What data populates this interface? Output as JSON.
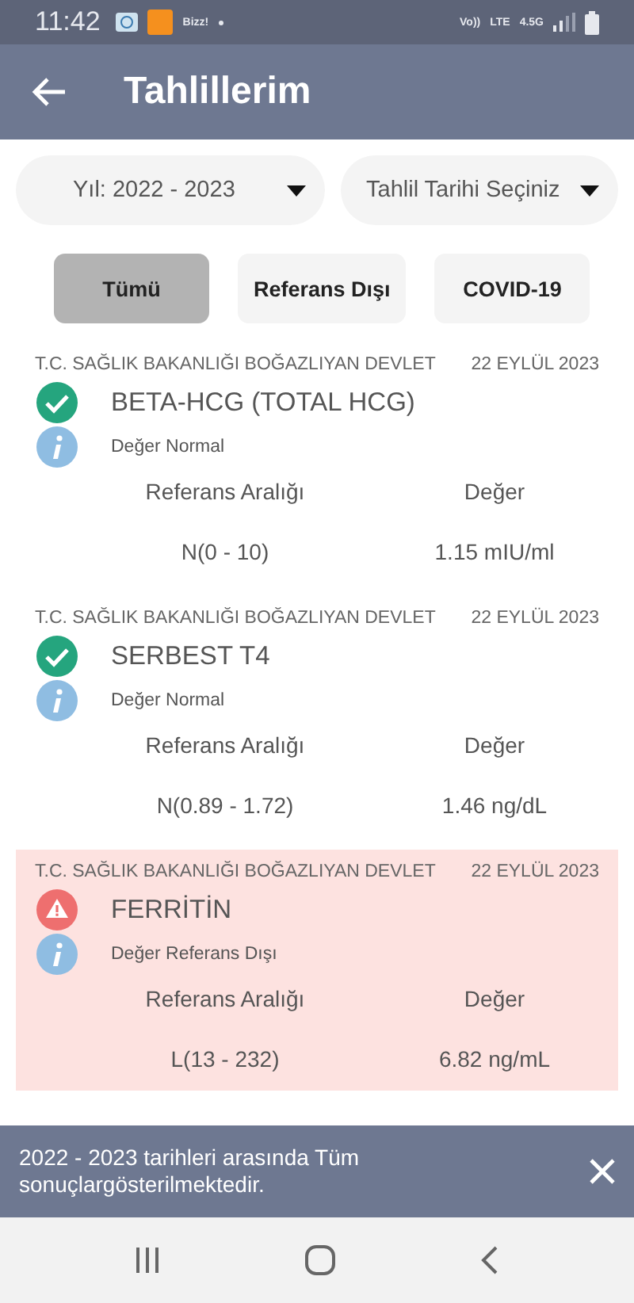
{
  "status_bar": {
    "time": "11:42",
    "notification_label": "Bizz!",
    "network_texts": [
      "Vo))",
      "LTE",
      "4.5G"
    ]
  },
  "app_bar": {
    "title": "Tahlillerim"
  },
  "filters": [
    {
      "label": "Yıl: 2022 - 2023"
    },
    {
      "label": "Tahlil Tarihi Seçiniz"
    }
  ],
  "tabs": [
    {
      "label": "Tümü",
      "selected": true
    },
    {
      "label": "Referans Dışı",
      "selected": false
    },
    {
      "label": "COVID-19",
      "selected": false
    }
  ],
  "results": [
    {
      "institution": "T.C. SAĞLIK BAKANLIĞI BOĞAZLIYAN DEVLET",
      "date": "22 EYLÜL 2023",
      "test": "BETA-HCG (TOTAL HCG)",
      "kind": "normal",
      "note": "Değer Normal",
      "range_label": "Referans Aralığı",
      "value_label": "Değer",
      "range": "N(0 - 10)",
      "value": "1.15 mIU/ml"
    },
    {
      "institution": "T.C. SAĞLIK BAKANLIĞI BOĞAZLIYAN DEVLET",
      "date": "22 EYLÜL 2023",
      "test": "SERBEST T4",
      "kind": "normal",
      "note": "Değer Normal",
      "range_label": "Referans Aralığı",
      "value_label": "Değer",
      "range": "N(0.89 - 1.72)",
      "value": "1.46 ng/dL"
    },
    {
      "institution": "T.C. SAĞLIK BAKANLIĞI BOĞAZLIYAN DEVLET",
      "date": "22 EYLÜL 2023",
      "test": "FERRİTİN",
      "kind": "abnormal",
      "note": "Değer Referans Dışı",
      "range_label": "Referans Aralığı",
      "value_label": "Değer",
      "range": "L(13 - 232)",
      "value": "6.82 ng/mL"
    }
  ],
  "snackbar": {
    "message": "2022 - 2023 tarihleri arasında Tüm sonuçlargösterilmektedir."
  }
}
